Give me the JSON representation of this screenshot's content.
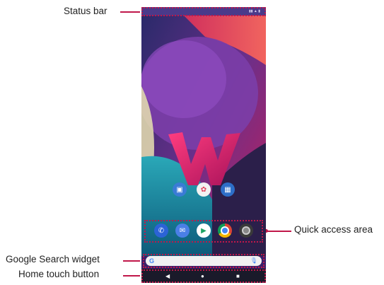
{
  "annotations": {
    "status_bar": "Status bar",
    "quick_access_area": "Quick access area",
    "google_search_widget": "Google Search widget",
    "home_touch_button": "Home touch button"
  },
  "home_apps": [
    {
      "icon": "store-icon",
      "label": "",
      "color": "#3a7bd5"
    },
    {
      "icon": "photos-icon",
      "label": "",
      "color": "#f2f2f2"
    },
    {
      "icon": "calendar-icon",
      "label": "",
      "color": "#2d6ec8"
    }
  ],
  "dock_apps": [
    {
      "icon": "phone-icon",
      "color": "#2b63d6"
    },
    {
      "icon": "messages-icon",
      "color": "#4a7fe6"
    },
    {
      "icon": "play-store-icon",
      "color": "#ffffff"
    },
    {
      "icon": "chrome-icon",
      "color": "#ffffff"
    },
    {
      "icon": "camera-icon",
      "color": "#3a3a3a"
    }
  ],
  "accent_color": "#c0174a"
}
